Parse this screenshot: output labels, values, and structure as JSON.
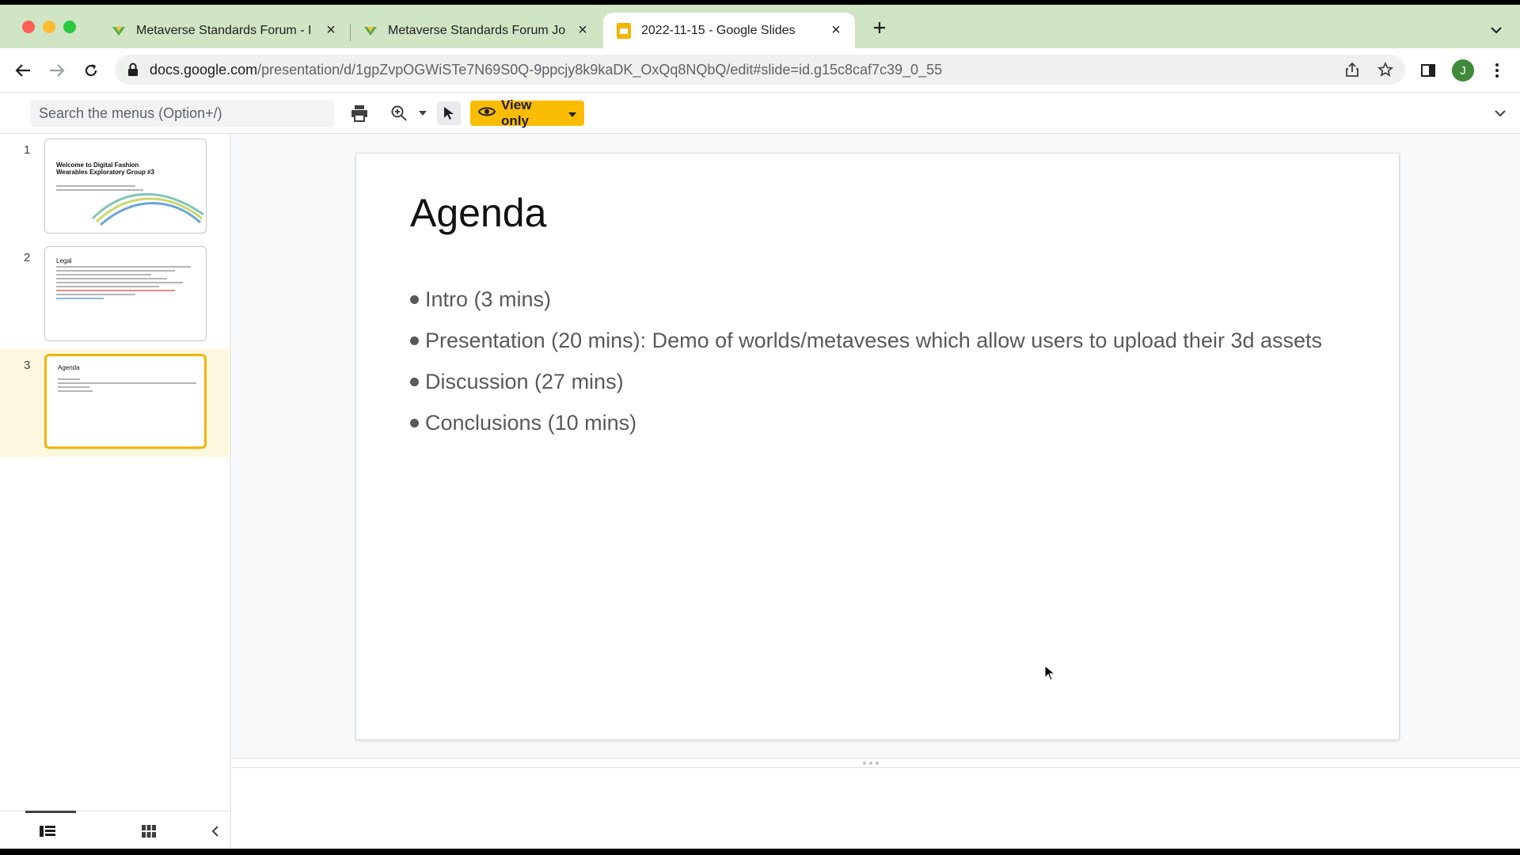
{
  "browser": {
    "tabs": [
      {
        "title": "Metaverse Standards Forum - I",
        "favicon": "mountain-checkmark-icon",
        "active": false
      },
      {
        "title": "Metaverse Standards Forum Jo",
        "favicon": "mountain-checkmark-icon",
        "active": false
      },
      {
        "title": "2022-11-15 - Google Slides",
        "favicon": "google-slides-icon",
        "active": true
      }
    ],
    "address": {
      "host": "docs.google.com",
      "path": "/presentation/d/1gpZvpOGWiSTe7N69S0Q-9ppcjy8k9kaDK_OxQq8NQbQ/edit#slide=id.g15c8caf7c39_0_55"
    },
    "profile_initial": "J"
  },
  "toolbar": {
    "search_placeholder": "Search the menus (Option+/)",
    "view_mode_label": "View only"
  },
  "filmstrip": {
    "slides": [
      {
        "number": "1",
        "title": "Welcome to Digital Fashion Wearables Exploratory Group #3",
        "selected": false
      },
      {
        "number": "2",
        "title": "Legal",
        "selected": false
      },
      {
        "number": "3",
        "title": "Agenda",
        "selected": true
      }
    ]
  },
  "slide": {
    "title": "Agenda",
    "bullets": [
      "Intro (3 mins)",
      "Presentation (20 mins): Demo of worlds/metaveses which allow users to upload their 3d assets",
      "Discussion (27 mins)",
      "Conclusions (10 mins)"
    ]
  },
  "colors": {
    "tabstrip": "#cfe5c4",
    "view_only_accent": "#fbbc04",
    "selected_slide_border": "#f4b400"
  }
}
